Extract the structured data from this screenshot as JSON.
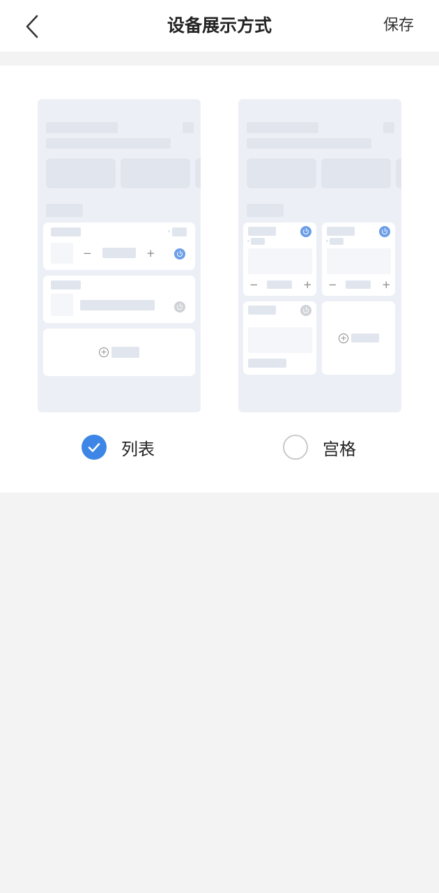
{
  "header": {
    "back_icon": "chevron-left-icon",
    "title": "设备展示方式",
    "save_label": "保存"
  },
  "options": [
    {
      "label": "列表",
      "selected": true
    },
    {
      "label": "宫格",
      "selected": false
    }
  ],
  "colors": {
    "accent": "#3d86e6",
    "preview_bg": "#ecf0f6",
    "page_bg": "#f3f3f4"
  }
}
